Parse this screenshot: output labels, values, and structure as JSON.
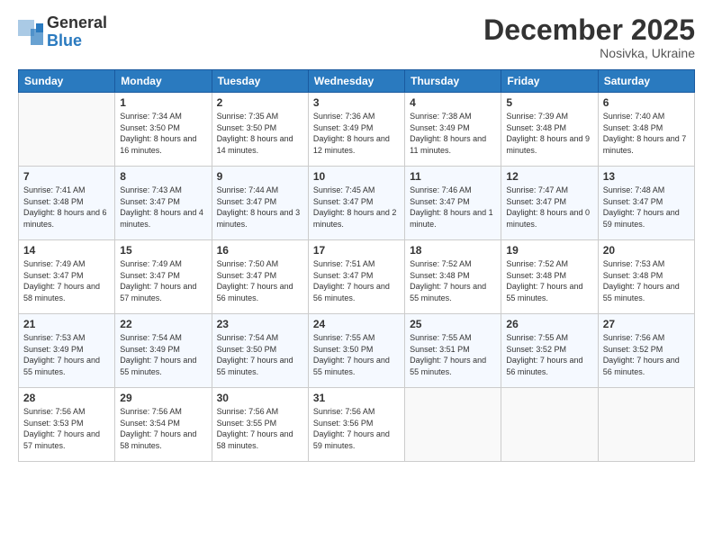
{
  "logo": {
    "general": "General",
    "blue": "Blue"
  },
  "title": "December 2025",
  "location": "Nosivka, Ukraine",
  "days_header": [
    "Sunday",
    "Monday",
    "Tuesday",
    "Wednesday",
    "Thursday",
    "Friday",
    "Saturday"
  ],
  "weeks": [
    [
      {
        "day": "",
        "sunrise": "",
        "sunset": "",
        "daylight": ""
      },
      {
        "day": "1",
        "sunrise": "7:34 AM",
        "sunset": "3:50 PM",
        "daylight": "8 hours and 16 minutes."
      },
      {
        "day": "2",
        "sunrise": "7:35 AM",
        "sunset": "3:50 PM",
        "daylight": "8 hours and 14 minutes."
      },
      {
        "day": "3",
        "sunrise": "7:36 AM",
        "sunset": "3:49 PM",
        "daylight": "8 hours and 12 minutes."
      },
      {
        "day": "4",
        "sunrise": "7:38 AM",
        "sunset": "3:49 PM",
        "daylight": "8 hours and 11 minutes."
      },
      {
        "day": "5",
        "sunrise": "7:39 AM",
        "sunset": "3:48 PM",
        "daylight": "8 hours and 9 minutes."
      },
      {
        "day": "6",
        "sunrise": "7:40 AM",
        "sunset": "3:48 PM",
        "daylight": "8 hours and 7 minutes."
      }
    ],
    [
      {
        "day": "7",
        "sunrise": "7:41 AM",
        "sunset": "3:48 PM",
        "daylight": "8 hours and 6 minutes."
      },
      {
        "day": "8",
        "sunrise": "7:43 AM",
        "sunset": "3:47 PM",
        "daylight": "8 hours and 4 minutes."
      },
      {
        "day": "9",
        "sunrise": "7:44 AM",
        "sunset": "3:47 PM",
        "daylight": "8 hours and 3 minutes."
      },
      {
        "day": "10",
        "sunrise": "7:45 AM",
        "sunset": "3:47 PM",
        "daylight": "8 hours and 2 minutes."
      },
      {
        "day": "11",
        "sunrise": "7:46 AM",
        "sunset": "3:47 PM",
        "daylight": "8 hours and 1 minute."
      },
      {
        "day": "12",
        "sunrise": "7:47 AM",
        "sunset": "3:47 PM",
        "daylight": "8 hours and 0 minutes."
      },
      {
        "day": "13",
        "sunrise": "7:48 AM",
        "sunset": "3:47 PM",
        "daylight": "7 hours and 59 minutes."
      }
    ],
    [
      {
        "day": "14",
        "sunrise": "7:49 AM",
        "sunset": "3:47 PM",
        "daylight": "7 hours and 58 minutes."
      },
      {
        "day": "15",
        "sunrise": "7:49 AM",
        "sunset": "3:47 PM",
        "daylight": "7 hours and 57 minutes."
      },
      {
        "day": "16",
        "sunrise": "7:50 AM",
        "sunset": "3:47 PM",
        "daylight": "7 hours and 56 minutes."
      },
      {
        "day": "17",
        "sunrise": "7:51 AM",
        "sunset": "3:47 PM",
        "daylight": "7 hours and 56 minutes."
      },
      {
        "day": "18",
        "sunrise": "7:52 AM",
        "sunset": "3:48 PM",
        "daylight": "7 hours and 55 minutes."
      },
      {
        "day": "19",
        "sunrise": "7:52 AM",
        "sunset": "3:48 PM",
        "daylight": "7 hours and 55 minutes."
      },
      {
        "day": "20",
        "sunrise": "7:53 AM",
        "sunset": "3:48 PM",
        "daylight": "7 hours and 55 minutes."
      }
    ],
    [
      {
        "day": "21",
        "sunrise": "7:53 AM",
        "sunset": "3:49 PM",
        "daylight": "7 hours and 55 minutes."
      },
      {
        "day": "22",
        "sunrise": "7:54 AM",
        "sunset": "3:49 PM",
        "daylight": "7 hours and 55 minutes."
      },
      {
        "day": "23",
        "sunrise": "7:54 AM",
        "sunset": "3:50 PM",
        "daylight": "7 hours and 55 minutes."
      },
      {
        "day": "24",
        "sunrise": "7:55 AM",
        "sunset": "3:50 PM",
        "daylight": "7 hours and 55 minutes."
      },
      {
        "day": "25",
        "sunrise": "7:55 AM",
        "sunset": "3:51 PM",
        "daylight": "7 hours and 55 minutes."
      },
      {
        "day": "26",
        "sunrise": "7:55 AM",
        "sunset": "3:52 PM",
        "daylight": "7 hours and 56 minutes."
      },
      {
        "day": "27",
        "sunrise": "7:56 AM",
        "sunset": "3:52 PM",
        "daylight": "7 hours and 56 minutes."
      }
    ],
    [
      {
        "day": "28",
        "sunrise": "7:56 AM",
        "sunset": "3:53 PM",
        "daylight": "7 hours and 57 minutes."
      },
      {
        "day": "29",
        "sunrise": "7:56 AM",
        "sunset": "3:54 PM",
        "daylight": "7 hours and 58 minutes."
      },
      {
        "day": "30",
        "sunrise": "7:56 AM",
        "sunset": "3:55 PM",
        "daylight": "7 hours and 58 minutes."
      },
      {
        "day": "31",
        "sunrise": "7:56 AM",
        "sunset": "3:56 PM",
        "daylight": "7 hours and 59 minutes."
      },
      {
        "day": "",
        "sunrise": "",
        "sunset": "",
        "daylight": ""
      },
      {
        "day": "",
        "sunrise": "",
        "sunset": "",
        "daylight": ""
      },
      {
        "day": "",
        "sunrise": "",
        "sunset": "",
        "daylight": ""
      }
    ]
  ]
}
